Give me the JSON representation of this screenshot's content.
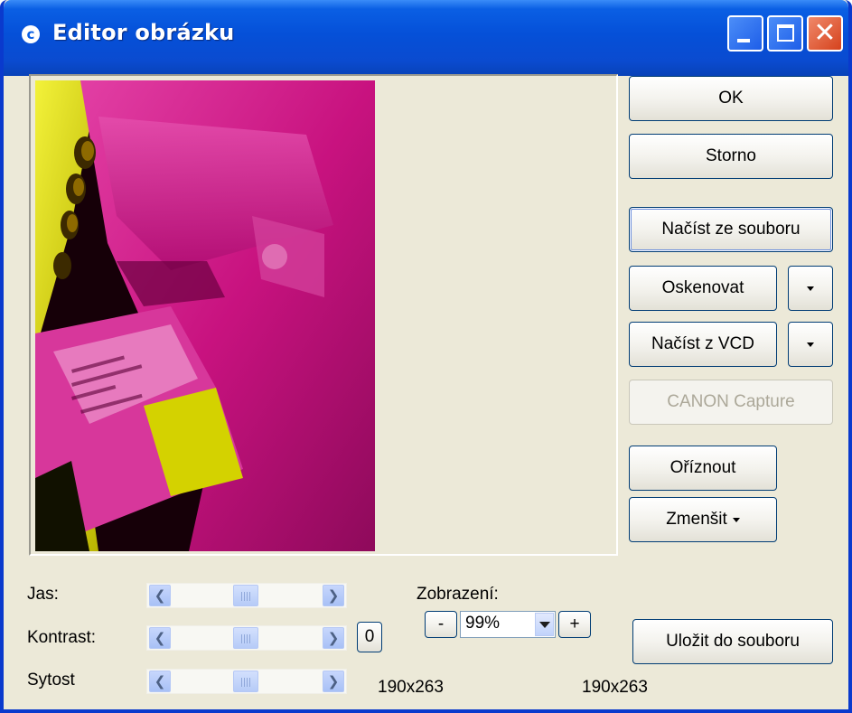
{
  "window": {
    "title": "Editor obrázku",
    "app_icon_glyph": "c",
    "controls": [
      "minimize-icon",
      "maximize-icon",
      "close-icon"
    ]
  },
  "preview": {
    "image_description_icon": "printer-photo-image"
  },
  "buttons": {
    "ok": "OK",
    "cancel": "Storno",
    "load_file": "Načíst ze souboru",
    "scan": "Oskenovat",
    "load_vcd": "Načíst z VCD",
    "canon_capture": "CANON Capture",
    "crop": "Oříznout",
    "shrink": "Zmenšit",
    "save_file": "Uložit do souboru",
    "reset_contrast": "0",
    "zoom_minus": "-",
    "zoom_plus": "+"
  },
  "adjustments": {
    "brightness_label": "Jas:",
    "contrast_label": "Kontrast:",
    "saturation_label": "Sytost"
  },
  "zoom": {
    "label": "Zobrazení:",
    "value": "99%"
  },
  "info": {
    "original_size": "190x263",
    "current_size": "190x263"
  },
  "colors": {
    "titlebar": "#0A5FE4",
    "dialog_background": "#ECE9D8",
    "image_magenta": "#C4087A",
    "image_yellow": "#E6E60A"
  }
}
